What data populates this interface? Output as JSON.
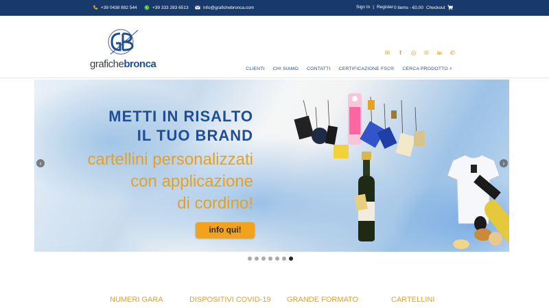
{
  "topbar": {
    "phone": "+39 0438 892 544",
    "whatsapp": "+39 333 283 6513",
    "email": "info@grafichebronca.com",
    "signin": "Sign In",
    "separator": "|",
    "register": "Register",
    "cart": "0 items - €0,00",
    "checkout": "Checkout"
  },
  "logo": {
    "part1": "grafiche",
    "part2": "bronca"
  },
  "social": [
    "email-icon",
    "facebook-icon",
    "instagram-icon",
    "pinterest-icon",
    "linkedin-icon",
    "whatsapp-icon"
  ],
  "nav": {
    "items": [
      "CLIENTI",
      "CHI SIAMO",
      "CONTATTI",
      "CERTIFICAZIONE FSC®",
      "CERCA PRODOTTO"
    ]
  },
  "slide": {
    "headline_1": "METTI IN RISALTO",
    "headline_2": "IL TUO BRAND",
    "sub_1": "cartellini personalizzati",
    "sub_2": "con applicazione",
    "sub_3": "di cordino!",
    "cta": "info qui!"
  },
  "slider": {
    "dots": 7,
    "active_index": 6
  },
  "categories": [
    "NUMERI GARA",
    "DISPOSITIVI COVID-19",
    "GRANDE FORMATO",
    "CARTELLINI"
  ],
  "colors": {
    "brand_blue": "#1e4f94",
    "topbar": "#183a6b",
    "accent_orange": "#e8a020"
  }
}
